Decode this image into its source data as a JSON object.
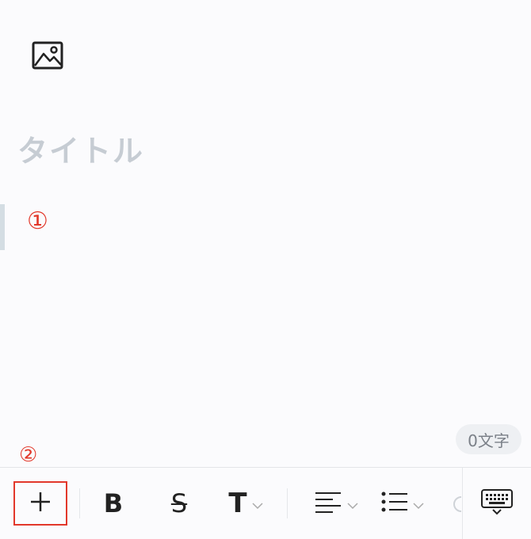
{
  "editor": {
    "title_placeholder": "タイトル",
    "body_value": ""
  },
  "annotations": {
    "marker_1": "①",
    "marker_2": "②",
    "color": "#e2382b"
  },
  "status": {
    "char_count": "0文字"
  },
  "toolbar": {
    "items": [
      {
        "name": "add",
        "icon": "plus-icon"
      },
      {
        "name": "bold",
        "icon": "bold-icon",
        "glyph": "B"
      },
      {
        "name": "strikethrough",
        "icon": "strikethrough-icon",
        "glyph": "S"
      },
      {
        "name": "text-size",
        "icon": "text-size-icon",
        "glyph": "T"
      },
      {
        "name": "align",
        "icon": "align-left-icon"
      },
      {
        "name": "list",
        "icon": "bulleted-list-icon"
      },
      {
        "name": "keyboard",
        "icon": "keyboard-icon"
      }
    ]
  },
  "colors": {
    "placeholder": "#c6ccd3",
    "accent_red": "#e2382b",
    "badge_bg": "#eef0f3"
  }
}
